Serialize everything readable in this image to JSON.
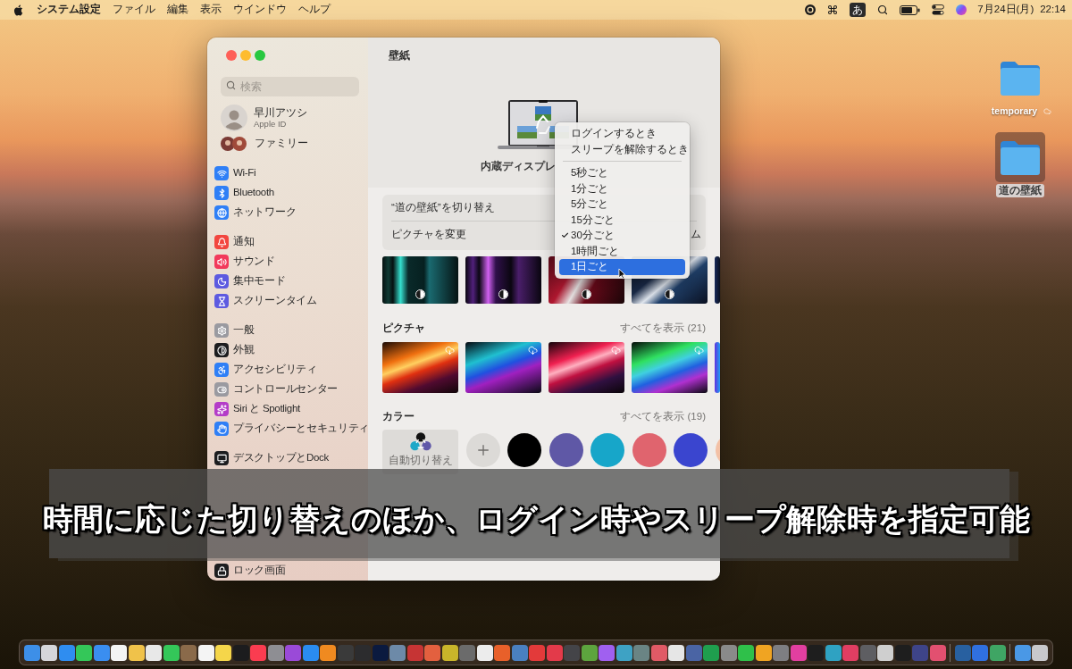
{
  "menu_bar": {
    "app_name": "システム設定",
    "menus": [
      "ファイル",
      "編集",
      "表示",
      "ウインドウ",
      "ヘルプ"
    ],
    "input_mode": "あ",
    "date": "7月24日(月)",
    "time": "22:14"
  },
  "desktop_items": [
    {
      "label": "temporary",
      "selected": false,
      "cloud_sync": true
    },
    {
      "label": "道の壁紙",
      "selected": true,
      "cloud_sync": false
    }
  ],
  "sidebar": {
    "search": {
      "placeholder": "検索"
    },
    "account": {
      "name": "早川アツシ",
      "subtitle": "Apple ID"
    },
    "family": {
      "label": "ファミリー"
    },
    "groups": [
      [
        {
          "label": "Wi-Fi",
          "kind": "wifi",
          "color": "#2f7ff6"
        },
        {
          "label": "Bluetooth",
          "kind": "bluetooth",
          "color": "#2f7ff6"
        },
        {
          "label": "ネットワーク",
          "kind": "network",
          "color": "#2f7ff6"
        }
      ],
      [
        {
          "label": "通知",
          "kind": "notifications",
          "color": "#f2463f"
        },
        {
          "label": "サウンド",
          "kind": "sound",
          "color": "#f2395b"
        },
        {
          "label": "集中モード",
          "kind": "focus",
          "color": "#5d5ae0"
        },
        {
          "label": "スクリーンタイム",
          "kind": "screentime",
          "color": "#5d5ae0"
        }
      ],
      [
        {
          "label": "一般",
          "kind": "general",
          "color": "#9a9aa0"
        },
        {
          "label": "外観",
          "kind": "appearance",
          "color": "#1d1d1f"
        },
        {
          "label": "アクセシビリティ",
          "kind": "accessibility",
          "color": "#2f7ff6"
        },
        {
          "label": "コントロールセンター",
          "kind": "controlcenter",
          "color": "#9a9aa0"
        },
        {
          "label": "Siri と Spotlight",
          "kind": "siri",
          "color": "#b43cc8"
        },
        {
          "label": "プライバシーとセキュリティ",
          "kind": "privacy",
          "color": "#2f7ff6"
        }
      ],
      [
        {
          "label": "デスクトップとDock",
          "kind": "desktop",
          "color": "#1d1d1f"
        }
      ]
    ],
    "bottom_items": [
      {
        "label": "ロック画面",
        "kind": "lock",
        "color": "#1d1d1f"
      }
    ]
  },
  "pane": {
    "title": "壁紙",
    "display_label": "内蔵ディスプレ",
    "settings": [
      {
        "label": "“道の壁紙”を切り替え"
      },
      {
        "label": "ピクチャを変更",
        "value": "ム"
      }
    ],
    "pictures": {
      "title": "ピクチャ",
      "show_all": "すべてを表示 (21)"
    },
    "colors": {
      "title": "カラー",
      "show_all": "すべてを表示 (19)",
      "auto_tile": {
        "label": "自動切り替え"
      },
      "swatches": [
        {
          "color": "#000000"
        },
        {
          "color": "#5f58a6"
        },
        {
          "color": "#17a6c9"
        },
        {
          "color": "#e0646e"
        },
        {
          "color": "#3a45cf"
        },
        {
          "color": "#f3c1a6"
        }
      ]
    }
  },
  "popup_menu": {
    "groups": [
      [
        {
          "label": "ログインするとき",
          "checked": false,
          "selected": false
        },
        {
          "label": "スリープを解除するとき",
          "checked": false,
          "selected": false
        }
      ],
      [
        {
          "label": "5秒ごと",
          "checked": false,
          "selected": false
        },
        {
          "label": "1分ごと",
          "checked": false,
          "selected": false
        },
        {
          "label": "5分ごと",
          "checked": false,
          "selected": false
        },
        {
          "label": "15分ごと",
          "checked": false,
          "selected": false
        },
        {
          "label": "30分ごと",
          "checked": true,
          "selected": false
        },
        {
          "label": "1時間ごと",
          "checked": false,
          "selected": false
        },
        {
          "label": "1日ごと",
          "checked": false,
          "selected": true
        }
      ]
    ]
  },
  "caption": "時間に応じた切り替えのほか、ログイン時やスリープ解除時を指定可能"
}
